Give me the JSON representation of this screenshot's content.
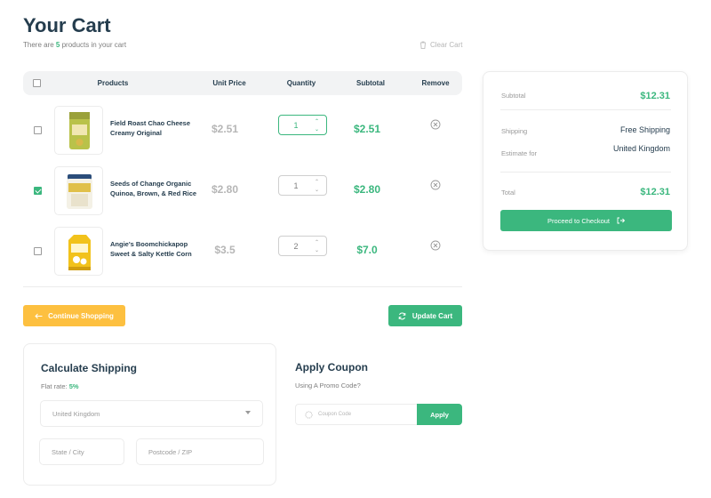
{
  "header": {
    "title": "Your Cart",
    "subtitle_prefix": "There are ",
    "product_count": "5",
    "subtitle_suffix": " products in your cart",
    "clear_cart_label": "Clear Cart"
  },
  "table": {
    "headers": {
      "products": "Products",
      "unit_price": "Unit Price",
      "quantity": "Quantity",
      "subtotal": "Subtotal",
      "remove": "Remove"
    },
    "rows": [
      {
        "name": "Field Roast Chao Cheese Creamy Original",
        "unit_price": "$2.51",
        "quantity": "1",
        "subtotal": "$2.51",
        "checked": false,
        "qty_active": true
      },
      {
        "name": "Seeds of Change Organic Quinoa, Brown, & Red Rice",
        "unit_price": "$2.80",
        "quantity": "1",
        "subtotal": "$2.80",
        "checked": true,
        "qty_active": false
      },
      {
        "name": "Angie's Boomchickapop Sweet & Salty Kettle Corn",
        "unit_price": "$3.5",
        "quantity": "2",
        "subtotal": "$7.0",
        "checked": false,
        "qty_active": false
      }
    ]
  },
  "actions": {
    "continue_label": "Continue Shopping",
    "update_label": "Update Cart"
  },
  "summary": {
    "subtotal_label": "Subtotal",
    "subtotal_value": "$12.31",
    "shipping_label": "Shipping",
    "shipping_value": "Free Shipping",
    "estimate_label": "Estimate for",
    "estimate_value": "United Kingdom",
    "total_label": "Total",
    "total_value": "$12.31",
    "checkout_label": "Proceed to Checkout"
  },
  "shipping": {
    "title": "Calculate Shipping",
    "flat_rate_prefix": "Flat rate: ",
    "flat_rate_value": "5%",
    "country_selected": "United Kingdom",
    "city_placeholder": "State / City",
    "postcode_placeholder": "Postcode / ZIP"
  },
  "coupon": {
    "title": "Apply Coupon",
    "subtitle": "Using A Promo Code?",
    "input_placeholder": "Coupon Code",
    "apply_label": "Apply"
  },
  "colors": {
    "brand_green": "#3bb77e",
    "accent_yellow": "#fdc040",
    "heading": "#253d4e",
    "muted": "#b6b6b6"
  },
  "icons": {
    "clear_cart": "trash-icon",
    "remove": "remove-circle-x-icon",
    "continue": "arrow-left-icon",
    "update": "refresh-icon",
    "checkout": "exit-arrow-icon",
    "coupon": "coupon-tag-icon"
  }
}
